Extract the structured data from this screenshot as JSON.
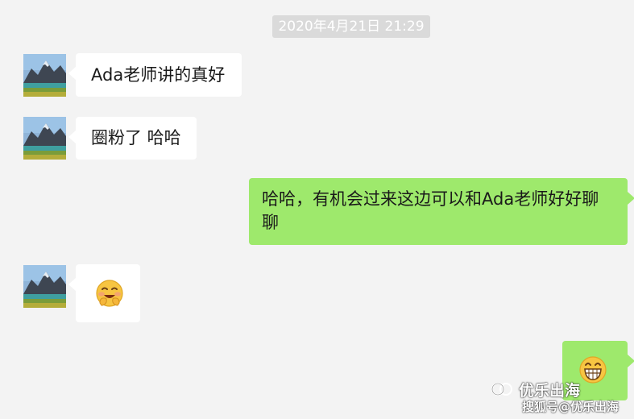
{
  "chat": {
    "timestamp": "2020年4月21日 21:29",
    "messages": [
      {
        "side": "left",
        "type": "text",
        "text": "Ada老师讲的真好"
      },
      {
        "side": "left",
        "type": "text",
        "text": "圈粉了 哈哈"
      },
      {
        "side": "right",
        "type": "text",
        "text": "哈哈，有机会过来这边可以和Ada老师好好聊聊"
      },
      {
        "side": "left",
        "type": "emoji",
        "icon": "blushing-grin-emoji-icon"
      },
      {
        "side": "right",
        "type": "emoji",
        "icon": "grinning-emoji-icon"
      }
    ]
  },
  "watermark": {
    "line1": "优乐出海",
    "line2": "搜狐号@优乐出海",
    "icon": "wechat-official-account-icon"
  },
  "colors": {
    "background": "#f3f3f3",
    "outgoing_bubble": "#9ee96c",
    "incoming_bubble": "#ffffff",
    "timestamp_bg": "#dadada"
  }
}
